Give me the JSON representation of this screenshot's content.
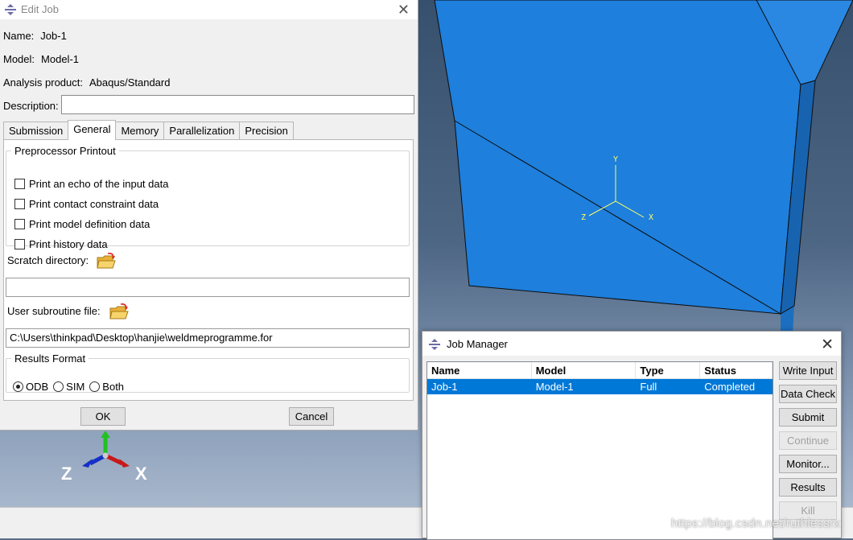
{
  "viewport": {
    "triad_labels": {
      "y": "Y",
      "x": "X",
      "z": "Z"
    },
    "mini_triad_labels": {
      "z": "Z",
      "x": "X"
    },
    "part_color": "#1e7fdc",
    "watermark": "https://blog.csdn.net/ruthlessrx"
  },
  "edit_job": {
    "title": "Edit Job",
    "name_label": "Name:",
    "name_value": "Job-1",
    "model_label": "Model:",
    "model_value": "Model-1",
    "product_label": "Analysis product:",
    "product_value": "Abaqus/Standard",
    "description_label": "Description:",
    "description_value": "",
    "tabs": [
      {
        "label": "Submission",
        "active": false
      },
      {
        "label": "General",
        "active": true
      },
      {
        "label": "Memory",
        "active": false
      },
      {
        "label": "Parallelization",
        "active": false
      },
      {
        "label": "Precision",
        "active": false
      }
    ],
    "preprocessor": {
      "legend": "Preprocessor Printout",
      "options": [
        {
          "label": "Print an echo of the input data",
          "checked": false
        },
        {
          "label": "Print contact constraint data",
          "checked": false
        },
        {
          "label": "Print model definition data",
          "checked": false
        },
        {
          "label": "Print history data",
          "checked": false
        }
      ]
    },
    "scratch_label": "Scratch directory:",
    "scratch_value": "",
    "subroutine_label": "User subroutine file:",
    "subroutine_value": "C:\\Users\\thinkpad\\Desktop\\hanjie\\weldmeprogramme.for",
    "results_format": {
      "legend": "Results Format",
      "options": [
        "ODB",
        "SIM",
        "Both"
      ],
      "selected": "ODB"
    },
    "ok_label": "OK",
    "cancel_label": "Cancel"
  },
  "job_manager": {
    "title": "Job Manager",
    "columns": [
      "Name",
      "Model",
      "Type",
      "Status"
    ],
    "rows": [
      {
        "name": "Job-1",
        "model": "Model-1",
        "type": "Full Analysis",
        "status": "Completed",
        "selected": true
      }
    ],
    "buttons": [
      {
        "label": "Write Input",
        "enabled": true
      },
      {
        "label": "Data Check",
        "enabled": true
      },
      {
        "label": "Submit",
        "enabled": true
      },
      {
        "label": "Continue",
        "enabled": false
      },
      {
        "label": "Monitor...",
        "enabled": true
      },
      {
        "label": "Results",
        "enabled": true
      },
      {
        "label": "Kill",
        "enabled": false
      }
    ],
    "selection_color": "#0078d7"
  }
}
